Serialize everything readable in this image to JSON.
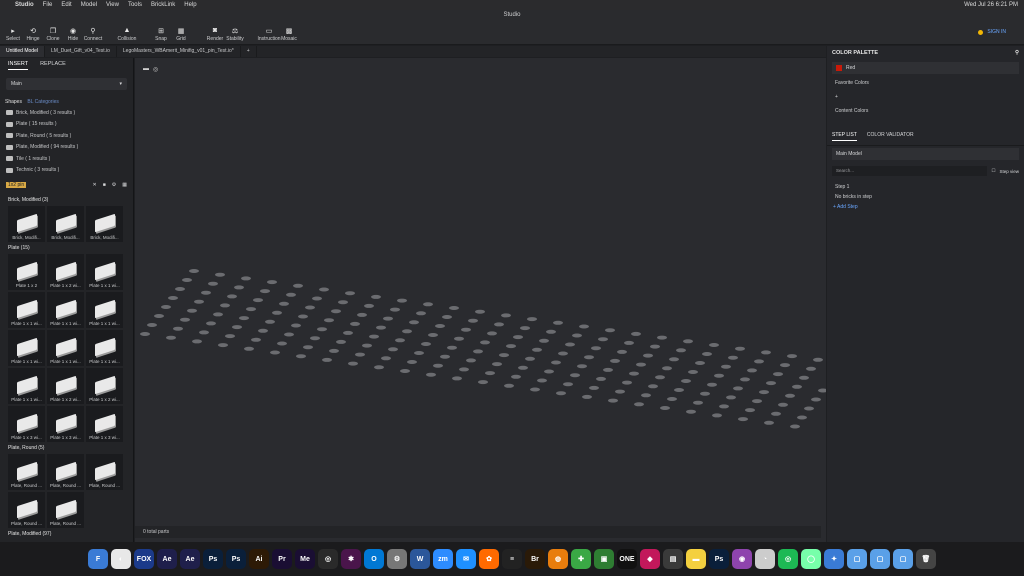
{
  "menubar": {
    "app": "Studio",
    "items": [
      "File",
      "Edit",
      "Model",
      "View",
      "Tools",
      "BrickLink",
      "Help"
    ],
    "clock": "Wed Jul 26  6:21 PM"
  },
  "window": {
    "title": "Studio"
  },
  "toolbar": {
    "tools": [
      {
        "label": "Select",
        "icon": "▸"
      },
      {
        "label": "Hinge",
        "icon": "⟲"
      },
      {
        "label": "Clone",
        "icon": "❐"
      },
      {
        "label": "Hide",
        "icon": "◉"
      },
      {
        "label": "Connect",
        "icon": "⚲"
      },
      {
        "label": "Collision",
        "icon": "▲",
        "gap": true
      },
      {
        "label": "Snap",
        "icon": "⊞",
        "gap": true
      },
      {
        "label": "Grid",
        "icon": "▦"
      },
      {
        "label": "Render",
        "icon": "◙",
        "gap": true
      },
      {
        "label": "Stability",
        "icon": "⚖"
      },
      {
        "label": "Instruction",
        "icon": "▭",
        "gap": true
      },
      {
        "label": "Mosaic",
        "icon": "▩"
      }
    ],
    "signin": "SIGN IN"
  },
  "tabs": [
    "Untitled Model",
    "LM_Duet_Gift_v04_Test.io",
    "LegoMasters_WBAmerit_Minifig_v01_pin_Test.io*"
  ],
  "left": {
    "subtabs": [
      "INSERT",
      "REPLACE"
    ],
    "palette": "Main",
    "shapes_label": "Shapes",
    "shapes_sub": "BL Categories",
    "categories": [
      "Brick, Modified ( 3 results )",
      "Plate ( 15 results )",
      "Plate, Round ( 5 results )",
      "Plate, Modified ( 94 results )",
      "Tile ( 1 results )",
      "Technic ( 3 results )"
    ],
    "search": "1x2 pin",
    "groups": [
      {
        "name": "Brick, Modified (3)",
        "items": [
          "Brick, Modifi...",
          "Brick, Modifi...",
          "Brick, Modifi..."
        ]
      },
      {
        "name": "Plate (15)",
        "items": [
          "Plate 1 x 2",
          "Plate 1 x 2 wi...",
          "Plate 1 x 1 wi...",
          "Plate 1 x 1 wi...",
          "Plate 1 x 1 wi...",
          "Plate 1 x 1 wi...",
          "Plate 1 x 1 wi...",
          "Plate 1 x 1 wi...",
          "Plate 1 x 1 wi...",
          "Plate 1 x 1 wi...",
          "Plate 1 x 2 wi...",
          "Plate 1 x 2 wi...",
          "Plate 1 x 3 wi...",
          "Plate 1 x 3 wi...",
          "Plate 1 x 3 wi..."
        ]
      },
      {
        "name": "Plate, Round (5)",
        "items": [
          "Plate, Round ...",
          "Plate, Round ...",
          "Plate, Round ...",
          "Plate, Round ...",
          "Plate, Round ..."
        ]
      },
      {
        "name": "Plate, Modified (97)",
        "items": []
      }
    ]
  },
  "viewport": {
    "status": "0 total parts"
  },
  "right": {
    "palette_title": "COLOR PALETTE",
    "color": "Red",
    "favorite": "Favorite Colors",
    "content": "Content Colors",
    "tabs": [
      "STEP LIST",
      "COLOR VALIDATOR"
    ],
    "model": "Main Model",
    "search_placeholder": "Search...",
    "step_view": "Step view",
    "step": "Step 1",
    "no_bricks": "No bricks in step",
    "add_step": "+ Add Step"
  },
  "colors": {
    "accent": "#6aa7ff",
    "red": "#c91a09"
  },
  "dock": [
    {
      "label": "F",
      "color": "#3a7bd5"
    },
    {
      "label": "◐",
      "color": "#e8e8e8"
    },
    {
      "label": "FOX",
      "color": "#1b3a8a"
    },
    {
      "label": "Ae",
      "color": "#1f1f4b"
    },
    {
      "label": "Ae",
      "color": "#1f1f4b"
    },
    {
      "label": "Ps",
      "color": "#0a1f3a"
    },
    {
      "label": "Ps",
      "color": "#0a1f3a"
    },
    {
      "label": "Ai",
      "color": "#2d1a06"
    },
    {
      "label": "Pr",
      "color": "#1a0e33"
    },
    {
      "label": "Me",
      "color": "#1a0e33"
    },
    {
      "label": "◎",
      "color": "#2a2a2a"
    },
    {
      "label": "✱",
      "color": "#4a154b"
    },
    {
      "label": "O",
      "color": "#0078d4"
    },
    {
      "label": "⚙",
      "color": "#777"
    },
    {
      "label": "W",
      "color": "#2b579a"
    },
    {
      "label": "zm",
      "color": "#2d8cff"
    },
    {
      "label": "✉",
      "color": "#1e90ff"
    },
    {
      "label": "✿",
      "color": "#ff6a00"
    },
    {
      "label": "≡",
      "color": "#222"
    },
    {
      "label": "Br",
      "color": "#2a1a08"
    },
    {
      "label": "◍",
      "color": "#e87d0d"
    },
    {
      "label": "✚",
      "color": "#3aa845"
    },
    {
      "label": "▣",
      "color": "#2e7d32"
    },
    {
      "label": "ONE",
      "color": "#111"
    },
    {
      "label": "◆",
      "color": "#c2185b"
    },
    {
      "label": "▤",
      "color": "#3a3a3a"
    },
    {
      "label": "▬",
      "color": "#f4d03f"
    },
    {
      "label": "Ps",
      "color": "#0a1f3a"
    },
    {
      "label": "◉",
      "color": "#8e44ad"
    },
    {
      "label": "◔",
      "color": "#ccc"
    },
    {
      "label": "◎",
      "color": "#1db954"
    },
    {
      "label": "◯",
      "color": "#7fa"
    },
    {
      "label": "✦",
      "color": "#3a7bd5"
    },
    {
      "label": "▢",
      "color": "#5aa0e8"
    },
    {
      "label": "▢",
      "color": "#5aa0e8"
    },
    {
      "label": "▢",
      "color": "#5aa0e8"
    },
    {
      "label": "🗑",
      "color": "#444"
    }
  ]
}
